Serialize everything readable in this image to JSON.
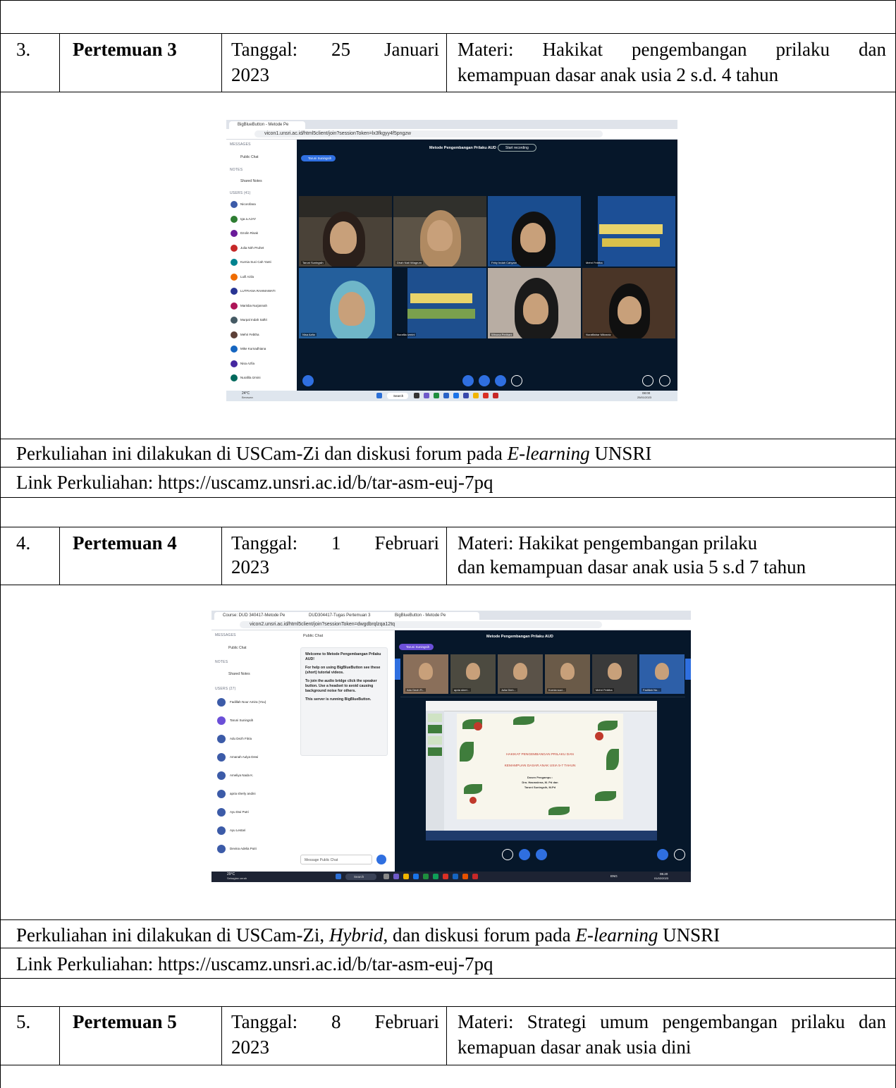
{
  "rows": [
    {
      "no": "3.",
      "title": "Pertemuan 3",
      "date_line1": "Tanggal:  25  Januari",
      "date_line2": "2023",
      "materi_line1": "Materi:  Hakikat  pengembangan  prilaku  dan",
      "materi_line2": "kemampuan dasar anak usia 2 s.d. 4 tahun",
      "note_pre": "Perkuliahan ini dilakukan di USCam-Zi dan diskusi forum pada ",
      "note_italic": "E-learning",
      "note_post": " UNSRI",
      "link": "Link Perkuliahan: https://uscamz.unsri.ac.id/b/tar-asm-euj-7pq"
    },
    {
      "no": "4.",
      "title": "Pertemuan 4",
      "date_line1": "Tanggal:  1  Februari",
      "date_line2": "2023",
      "materi_line1": "Materi: Hakikat pengembangan prilaku",
      "materi_line2": "dan kemampuan dasar anak usia 5 s.d 7 tahun",
      "note_pre": "Perkuliahan ini dilakukan di USCam-Zi, ",
      "note_italic": "Hybrid",
      "note_mid": ", dan diskusi forum pada ",
      "note_italic2": "E-learning",
      "note_post": " UNSRI",
      "link": "Link Perkuliahan: https://uscamz.unsri.ac.id/b/tar-asm-euj-7pq"
    },
    {
      "no": "5.",
      "title": "Pertemuan 5",
      "date_line1": "Tanggal:  8  Februari",
      "date_line2": "2023",
      "materi_line1": "Materi: Strategi umum pengembangan prilaku dan",
      "materi_line2": "kemapuan dasar anak usia dini"
    }
  ],
  "shot1": {
    "tab": "BigBlueButton - Metode Pe",
    "url": "vicon1.unsri.ac.id/html5client/join?sessionToken=lx3fkgyy4f5pngzw",
    "messages": "MESSAGES",
    "public_chat": "Public Chat",
    "notes": "NOTES",
    "shared_notes": "Shared Notes",
    "users": "USERS (41)",
    "user_names": [
      "Nicorofana",
      "Iga a.AJAY",
      "Dzolin Risak",
      "Julia Nirh Pruhet",
      "Kurnia Suci Cah Yanti",
      "Luifi Azila",
      "LUTFIANA RAHMAWATI",
      "Marisba Nurjannah",
      "Murpal Indah Saftri",
      "Mehri Febtha",
      "Mike Kurnadhiana",
      "Nisa Azfia",
      "Nurafila Izmini"
    ],
    "title": "Metode Pengembangan Prilaku AUD",
    "record": "Start recording",
    "presenter": "Taruni Suningsih",
    "tile_names": [
      "Taruni Suningsih",
      "Dhah Nati Wiagrum",
      "Feby Indah Cahyani",
      "Mehri Febtha",
      "Nisa Azfia",
      "Nurafila Izmini",
      "Winona Perihani",
      "Nuralfiahar Mikraniz"
    ],
    "weather": "24°C",
    "weather_sub": "Berawan",
    "search": "Search",
    "clock": "08:00",
    "date": "25/01/2023"
  },
  "shot2": {
    "tabs": [
      "Course: DUD 340417-Metode Pe",
      "DUD304417-Tugas Pertemuan 3",
      "BigBlueButton - Metode Pe"
    ],
    "url": "vicon2.unsri.ac.id/html5client/join?sessionToken=dwgdbrqlzqa12tq",
    "messages": "MESSAGES",
    "public_chat": "Public Chat",
    "notes": "NOTES",
    "shared_notes": "Shared Notes",
    "users": "USERS (27)",
    "user_names": [
      "Fadillah Nour Amira (You)",
      "Taruni Suningsih",
      "Adu Dezh Fitria",
      "Amanah Aulya Dewi",
      "Ameliya Nada K.",
      "apria sherly andini",
      "Ayu Dwi Putri",
      "Ayu Lestari",
      "Devina Adelia Putri"
    ],
    "chat_header": "Public Chat",
    "welcome": "Welcome to Metode Pengembangan Prilaku AUD!",
    "help": "For help on using BigBlueButton see these (short) tutorial videos.",
    "audio": "To join the audio bridge click the speaker button. Use a headset to avoid causing background noise for others.",
    "server": "This server is running BigBlueButton.",
    "input_placeholder": "Message Public Chat",
    "title": "Metode Pengembangan Prilaku AUD",
    "presenter": "Taruni Suningsih",
    "strip_names": [
      "Adu Dezh Fi...",
      "apria sheri...",
      "Julia Dinh...",
      "Kurnia suci...",
      "Mehri Febtha",
      "Fadillah No..."
    ],
    "slide_line1": "HAKIKAT PENGEMBANGAN PRILAKU DAN",
    "slide_line2": "KEMAMPUAN DASAR ANAK USIA 5-7 TAHUN",
    "slide_dosen": "Dosen Pengampu :",
    "slide_d1": "Dra. Hasmalena, M. Pd dan",
    "slide_d2": "Taruni Suningsih, M.Pd",
    "weather": "29°C",
    "weather_sub": "Sebagian cerah",
    "search": "Search",
    "lang": "ENG",
    "clock": "08.20",
    "date": "01/02/2023"
  }
}
